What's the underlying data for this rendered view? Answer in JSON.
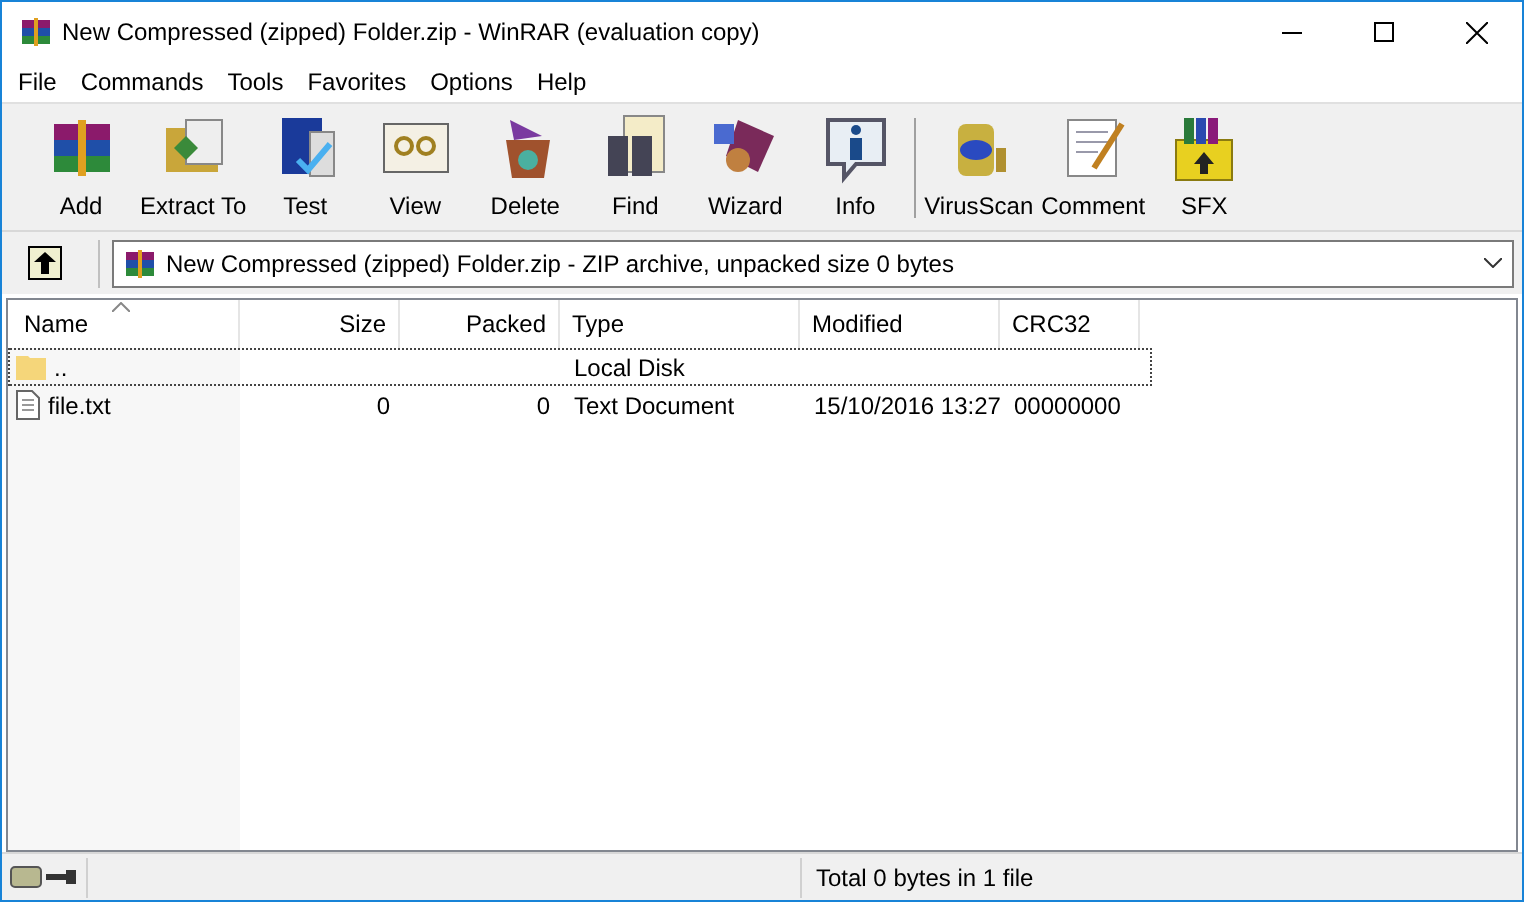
{
  "window": {
    "title": "New Compressed (zipped) Folder.zip - WinRAR (evaluation copy)"
  },
  "menu": [
    "File",
    "Commands",
    "Tools",
    "Favorites",
    "Options",
    "Help"
  ],
  "toolbar": [
    {
      "label": "Add",
      "separator_before": false
    },
    {
      "label": "Extract To",
      "separator_before": false
    },
    {
      "label": "Test",
      "separator_before": false
    },
    {
      "label": "View",
      "separator_before": false
    },
    {
      "label": "Delete",
      "separator_before": false
    },
    {
      "label": "Find",
      "separator_before": false
    },
    {
      "label": "Wizard",
      "separator_before": false
    },
    {
      "label": "Info",
      "separator_before": false
    },
    {
      "label": "VirusScan",
      "separator_before": true
    },
    {
      "label": "Comment",
      "separator_before": false
    },
    {
      "label": "SFX",
      "separator_before": false
    }
  ],
  "address": {
    "value": "New Compressed (zipped) Folder.zip - ZIP archive, unpacked size 0 bytes"
  },
  "table": {
    "columns": [
      {
        "label": "Name",
        "sorted": true
      },
      {
        "label": "Size",
        "sorted": false
      },
      {
        "label": "Packed",
        "sorted": false
      },
      {
        "label": "Type",
        "sorted": false
      },
      {
        "label": "Modified",
        "sorted": false
      },
      {
        "label": "CRC32",
        "sorted": false
      }
    ],
    "rows": [
      {
        "kind": "folder",
        "focused": true,
        "cells": [
          "..",
          "",
          "",
          "Local Disk",
          "",
          ""
        ]
      },
      {
        "kind": "file",
        "focused": false,
        "cells": [
          "file.txt",
          "0",
          "0",
          "Text Document",
          "15/10/2016 13:27",
          "00000000"
        ]
      }
    ]
  },
  "status_bar": {
    "text": "Total 0 bytes in 1 file"
  }
}
